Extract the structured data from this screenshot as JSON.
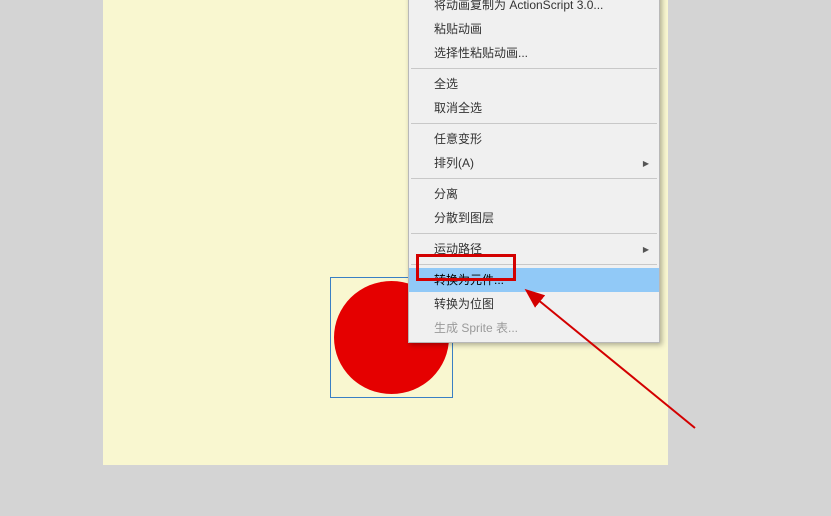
{
  "context_menu": {
    "items": [
      {
        "label": "将动画复制为 ActionScript 3.0...",
        "disabled": false,
        "submenu": false
      },
      {
        "label": "粘贴动画",
        "disabled": false,
        "submenu": false
      },
      {
        "label": "选择性粘贴动画...",
        "disabled": false,
        "submenu": false
      },
      {
        "label": "全选",
        "disabled": false,
        "submenu": false
      },
      {
        "label": "取消全选",
        "disabled": false,
        "submenu": false
      },
      {
        "label": "任意变形",
        "disabled": false,
        "submenu": false
      },
      {
        "label": "排列(A)",
        "disabled": false,
        "submenu": true
      },
      {
        "label": "分离",
        "disabled": false,
        "submenu": false
      },
      {
        "label": "分散到图层",
        "disabled": false,
        "submenu": false
      },
      {
        "label": "运动路径",
        "disabled": false,
        "submenu": true
      },
      {
        "label": "转换为元件...",
        "disabled": false,
        "submenu": false,
        "highlighted": true
      },
      {
        "label": "转换为位图",
        "disabled": false,
        "submenu": false
      },
      {
        "label": "生成 Sprite 表...",
        "disabled": true,
        "submenu": false
      }
    ]
  },
  "canvas": {
    "shape": "circle",
    "shape_color": "#e50000",
    "background": "#f9f7d0"
  }
}
